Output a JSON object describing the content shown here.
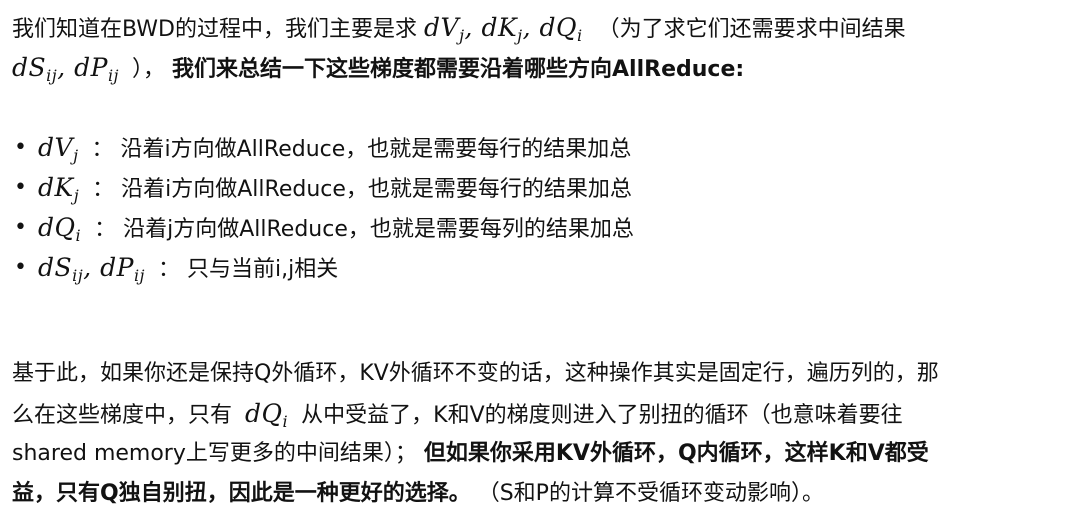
{
  "intro": {
    "line1_text": "我们知道在BWD的过程中，我们主要是求",
    "line1_math": [
      "dV",
      "j",
      ", dK",
      "j",
      ", dQ",
      "i"
    ],
    "line1_tail": "（为了求它们还需要求中间结果",
    "line2_math": [
      "dS",
      "ij",
      ", dP",
      "ij"
    ],
    "line2_close": "），",
    "line2_bold": "我们来总结一下这些梯度都需要沿着哪些方向AllReduce:"
  },
  "bullets": [
    {
      "math_base": "dV",
      "math_sub": "j",
      "text": "：  沿着i方向做AllReduce，也就是需要每行的结果加总"
    },
    {
      "math_base": "dK",
      "math_sub": "j",
      "text": "：  沿着i方向做AllReduce，也就是需要每行的结果加总"
    },
    {
      "math_base": "dQ",
      "math_sub": "i",
      "text": "：   沿着j方向做AllReduce，也就是需要每列的结果加总"
    },
    {
      "math_base": "dS",
      "math_sub": "ij",
      "math_base2": ", dP",
      "math_sub2": "ij",
      "text": "：  只与当前i,j相关"
    }
  ],
  "conclusion": {
    "l1": "基于此，如果你还是保持Q外循环，KV外循环不变的话，这种操作其实是固定行，遍历列的，那",
    "l2_pre": "么在这些梯度中，只有",
    "l2_math_base": "dQ",
    "l2_math_sub": "i",
    "l2_post": "从中受益了，K和V的梯度则进入了别扭的循环（也意味着要往",
    "l3_pre": "shared memory上写更多的中间结果）；",
    "l3_bold": "但如果你采用KV外循环，Q内循环，这样K和V都受",
    "l4_bold": "益，只有Q独自别扭，因此是一种更好的选择。",
    "l4_post": "（S和P的计算不受循环变动影响）。"
  }
}
